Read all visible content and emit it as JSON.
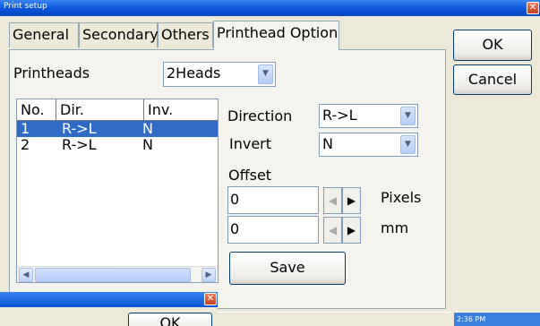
{
  "window": {
    "title": "Print setup"
  },
  "tabs": [
    {
      "label": "General"
    },
    {
      "label": "Secondary"
    },
    {
      "label": "Others"
    },
    {
      "label": "Printhead Option"
    }
  ],
  "buttons": {
    "ok": "OK",
    "cancel": "Cancel",
    "save": "Save"
  },
  "printheads": {
    "label": "Printheads",
    "value": "2Heads"
  },
  "table": {
    "columns": [
      "No.",
      "Dir.",
      "Inv."
    ],
    "rows": [
      {
        "no": "1",
        "dir": "R->L",
        "inv": "N",
        "selected": true
      },
      {
        "no": "2",
        "dir": "R->L",
        "inv": "N",
        "selected": false
      }
    ]
  },
  "direction": {
    "label": "Direction",
    "value": "R->L"
  },
  "invert": {
    "label": "Invert",
    "value": "N"
  },
  "offset": {
    "label": "Offset",
    "pixels_value": "0",
    "pixels_unit": "Pixels",
    "mm_value": "0",
    "mm_unit": "mm"
  },
  "dialog2": {
    "ok_label": "OK"
  },
  "taskbar": {
    "clock": "2:36 PM"
  },
  "colors": {
    "title_bar": "#0a55d8",
    "selection": "#316ac5",
    "close": "#c8401f"
  },
  "icons": [
    "close-icon",
    "chevron-down-icon",
    "arrow-left-icon",
    "arrow-right-icon"
  ]
}
